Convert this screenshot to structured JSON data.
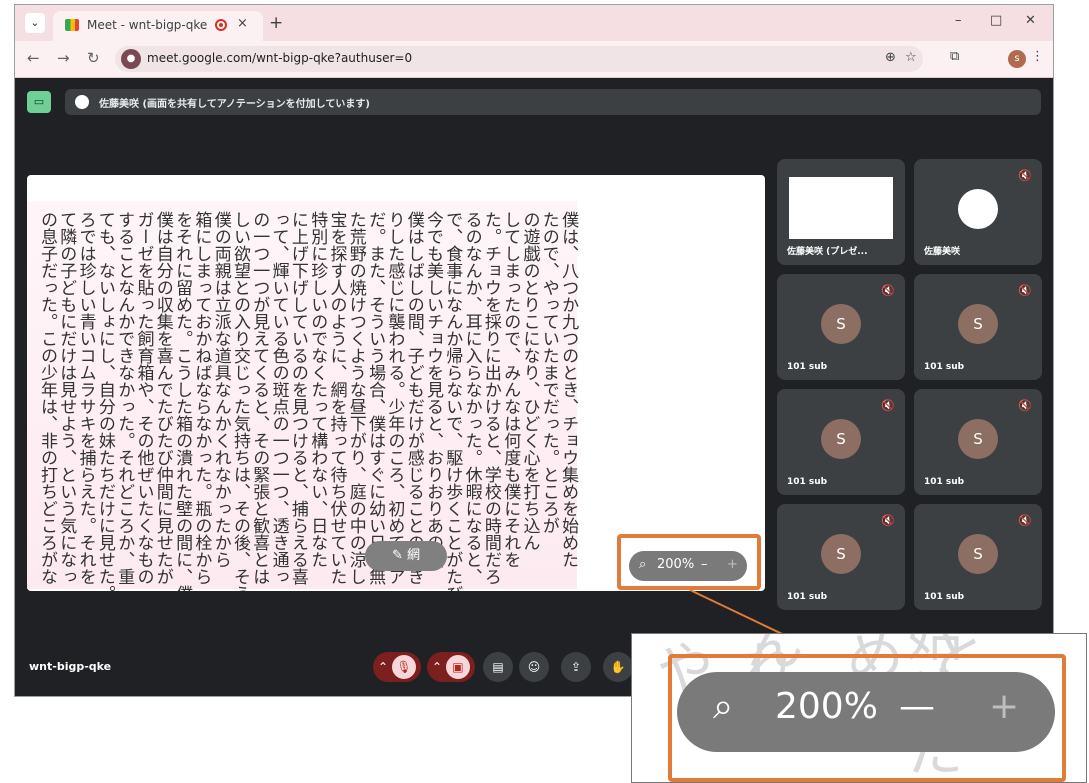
{
  "browser": {
    "tab_title": "Meet - wnt-bigp-qke",
    "tab_close": "×",
    "new_tab": "+",
    "win_min": "–",
    "win_max": "□",
    "win_close": "✕",
    "url": "meet.google.com/wnt-bigp-qke?authuser=0",
    "profile_initial": "s"
  },
  "banner": {
    "text": "佐藤美咲 (画面を共有してアノテーションを付加しています)"
  },
  "shared_document": {
    "columns": [
      "の息子だった。この少年は、非の打ちどころがな",
      "て隣の子どもにだけは見せよう、という気になっ",
      "ろでは珍しい青いコムラサキを捕らえた。それを",
      "ても、ないしょにし、自分の妹たちだけに見せた。",
      "することなんかできなかった。それどころか、重",
      "ガーゼを貼った飼育箱や、その他ぜいたくなもの",
      "僕は自分の収集を喜んでたびたび仲間に見せたが",
      "をそれに留めた。こうした箱の潰れた壁の間に、僕",
      "箱にしまっておかねばならなかった。瓶の栓から",
      "僕の両親は立派な道具なんかくれなかったから",
      "しい欲望との入り交じった気持ちは、その後、そう",
      "の一つ一つが見えてくると、その緊張と歓喜とは",
      "って、輝いている色の斑点の一つ一つ、透き通っ",
      "に上げ下げしているのを見つけると、捕らえる喜",
      "特別に珍しいのでなくたって構わない、日なた",
      "宝を探す人のように、網を持って待ち伏せていた",
      "た荒野の焼けつくような昼下がり、庭の中の涼し",
      "だ。また、そういう場合、僕はすぐに幼い日の無",
      "りした感じに襲われる。少年のころ、初めてキア",
      "僕はしばしの間、子どもだけが感じることのでき",
      "今でも美しいチョウを見ると、おりおりあの熱",
      "で、食事になんか帰らないで、駆け歩くことがたび",
      "るのなんか、耳に入らなかった。休暇になると、",
      "た。チョウを採りに出かけると、学校の時間だろ",
      "してしまったので、みんなは何度も僕にそれを",
      "の遊戯のとりこになり、ひどく心を打ち込ん",
      "たので、やっていたまでだった。ところが",
      "僕は、八つか九つのとき、チョウ集めを始めた"
    ],
    "annotation_pill": "網",
    "zoom_level": "200%",
    "zoom_minus": "–",
    "zoom_plus": "+"
  },
  "participants": [
    {
      "name": "佐藤美咲 (プレゼ...",
      "type": "presentation"
    },
    {
      "name": "佐藤美咲",
      "type": "sketch"
    },
    {
      "name": "101 sub",
      "initial": "S"
    },
    {
      "name": "101 sub",
      "initial": "S"
    },
    {
      "name": "101 sub",
      "initial": "S"
    },
    {
      "name": "101 sub",
      "initial": "S"
    },
    {
      "name": "101 sub",
      "initial": "S"
    },
    {
      "name": "101 sub",
      "initial": "S"
    }
  ],
  "meeting_code": "wnt-bigp-qke",
  "zoom_callout": {
    "zoom_level": "200%",
    "zoom_minus": "—",
    "zoom_plus": "+",
    "background_glyphs": [
      "れそや",
      "んて",
      "ときめ",
      "始めた"
    ]
  },
  "colors": {
    "highlight": "#e07b39",
    "accent_green": "#6fcf97",
    "avatar": "#8d6e63"
  }
}
